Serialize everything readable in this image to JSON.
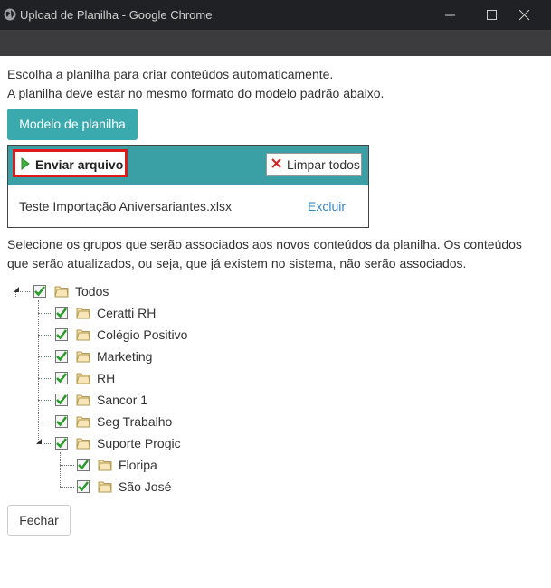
{
  "window": {
    "title": "Upload de Planilha - Google Chrome",
    "icon": "globe-icon"
  },
  "intro": {
    "line1": "Escolha a planilha para criar conteúdos automaticamente.",
    "line2": "A planilha deve estar no mesmo formato do modelo padrão abaixo."
  },
  "model_button": {
    "label": "Modelo de planilha",
    "color": "#3aaaaf"
  },
  "upload": {
    "send_label": "Enviar arquivo",
    "clear_label": "Limpar todos",
    "header_color": "#3aa0a6",
    "highlight_color": "#e01a1a",
    "file": {
      "name": "Teste Importação Aniversariantes.xlsx",
      "delete_label": "Excluir"
    }
  },
  "groups": {
    "description": "Selecione os grupos que serão associados aos novos conteúdos da planilha. Os conteúdos que serão atualizados, ou seja, que já existem no sistema, não serão associados.",
    "root": {
      "label": "Todos",
      "checked": true
    },
    "children": [
      {
        "label": "Ceratti RH",
        "checked": true
      },
      {
        "label": "Colégio Positivo",
        "checked": true
      },
      {
        "label": "Marketing",
        "checked": true
      },
      {
        "label": "RH",
        "checked": true
      },
      {
        "label": "Sancor 1",
        "checked": true
      },
      {
        "label": "Seg Trabalho",
        "checked": true
      },
      {
        "label": "Suporte Progic",
        "checked": true,
        "children": [
          {
            "label": "Floripa",
            "checked": true
          },
          {
            "label": "São José",
            "checked": true
          }
        ]
      }
    ]
  },
  "close_button": {
    "label": "Fechar"
  }
}
